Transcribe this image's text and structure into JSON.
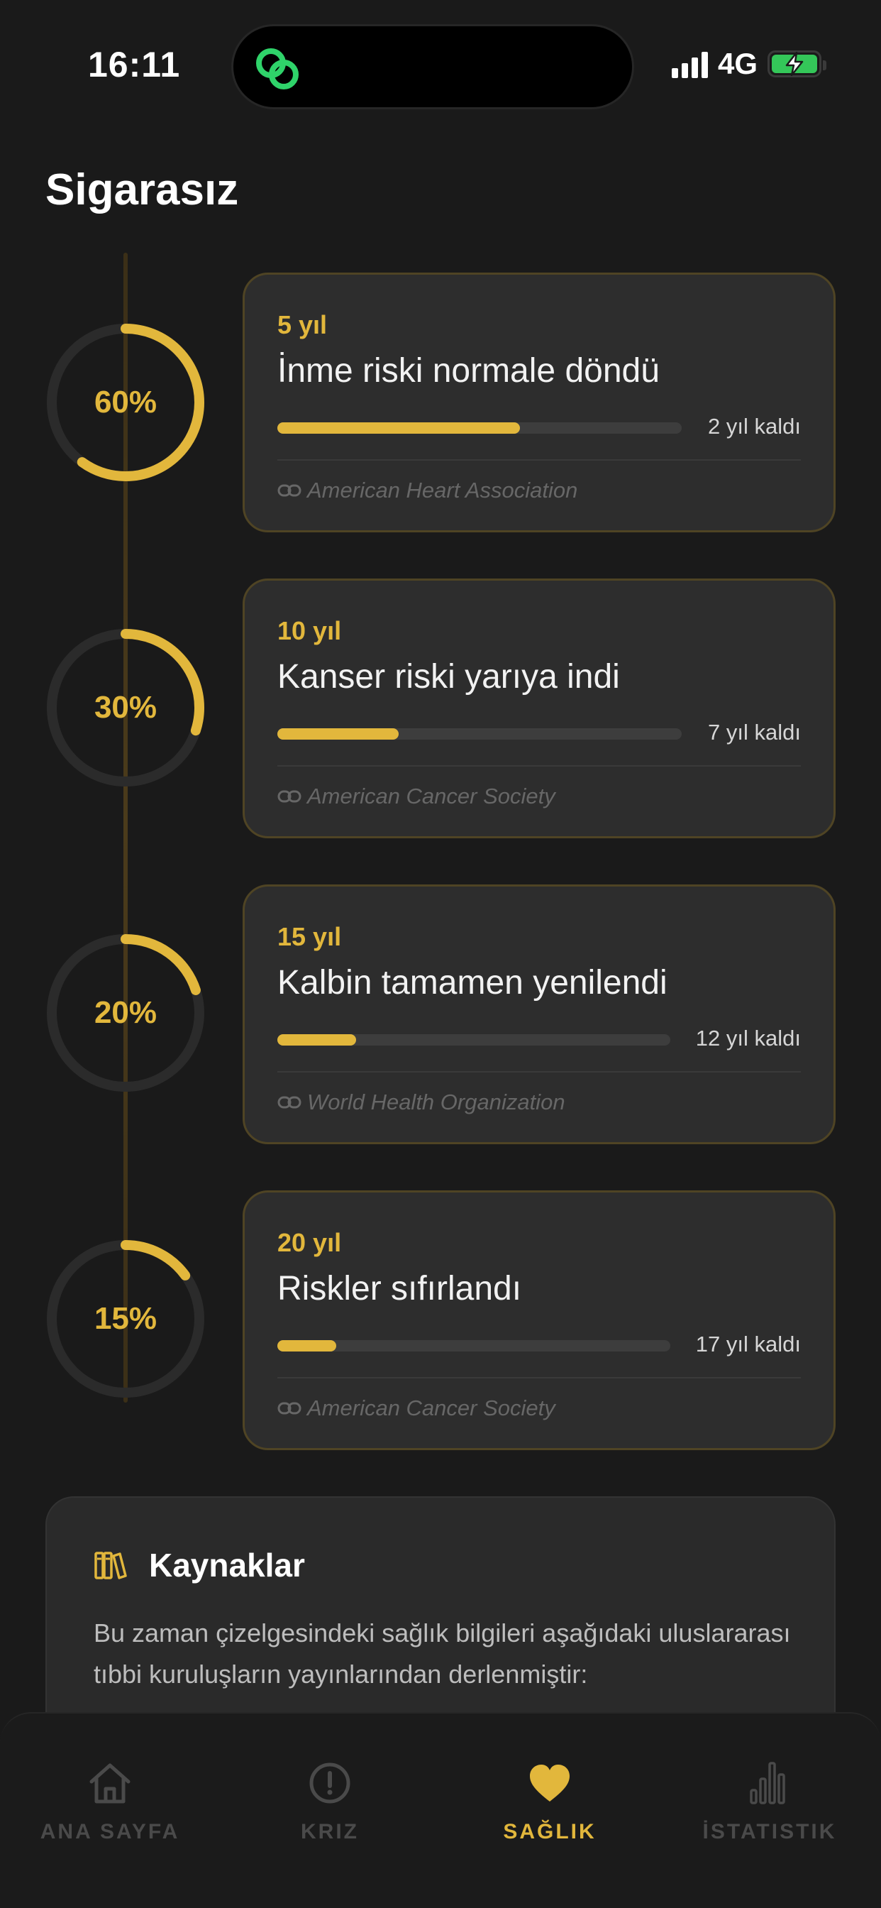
{
  "status_bar": {
    "time": "16:11",
    "network": "4G"
  },
  "page": {
    "title": "Sigarasız"
  },
  "milestones": [
    {
      "percent": "60%",
      "percent_value": 60,
      "period": "5 yıl",
      "title": "İnme riski normale döndü",
      "progress": 0.6,
      "remaining": "2 yıl kaldı",
      "source": "American Heart Association"
    },
    {
      "percent": "30%",
      "percent_value": 30,
      "period": "10 yıl",
      "title": "Kanser riski yarıya indi",
      "progress": 0.3,
      "remaining": "7 yıl kaldı",
      "source": "American Cancer Society"
    },
    {
      "percent": "20%",
      "percent_value": 20,
      "period": "15 yıl",
      "title": "Kalbin tamamen yenilendi",
      "progress": 0.2,
      "remaining": "12 yıl kaldı",
      "source": "World Health Organization"
    },
    {
      "percent": "15%",
      "percent_value": 15,
      "period": "20 yıl",
      "title": "Riskler sıfırlandı",
      "progress": 0.15,
      "remaining": "17 yıl kaldı",
      "source": "American Cancer Society"
    }
  ],
  "sources_card": {
    "title": "Kaynaklar",
    "text": "Bu zaman çizelgesindeki sağlık bilgileri aşağıdaki uluslararası tıbbi kuruluşların yayınlarından derlenmiştir:"
  },
  "tab_bar": {
    "tabs": [
      {
        "label": "ANA SAYFA",
        "icon": "home-icon",
        "active": false
      },
      {
        "label": "KRIZ",
        "icon": "alert-circle-icon",
        "active": false
      },
      {
        "label": "SAĞLIK",
        "icon": "heart-icon",
        "active": true
      },
      {
        "label": "İSTATISTIK",
        "icon": "bar-chart-icon",
        "active": false
      }
    ]
  },
  "colors": {
    "accent": "#e2b73c",
    "background": "#1a1a1a",
    "card": "#2d2d2d",
    "battery": "#34c759",
    "logo": "#2fd36a"
  }
}
